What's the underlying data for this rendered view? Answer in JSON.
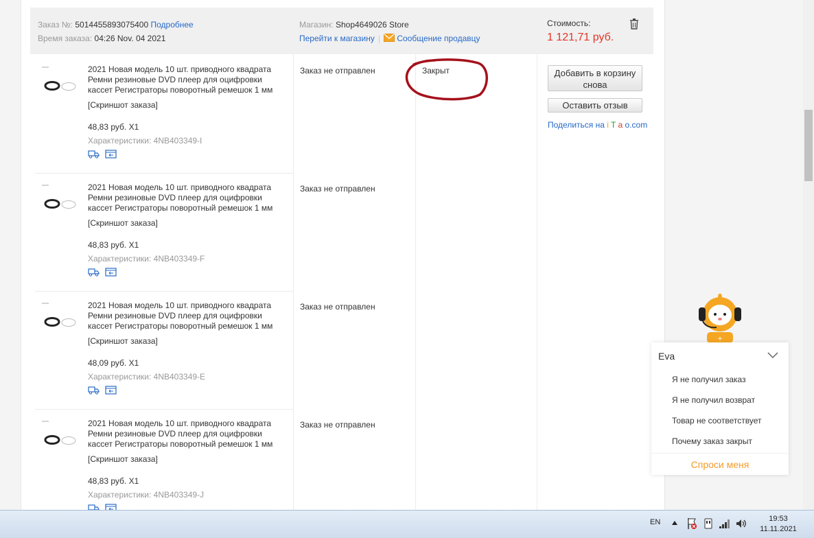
{
  "order": {
    "number_label": "Заказ №:",
    "number": "5014455893075400",
    "details_link": "Подробнее",
    "time_label": "Время заказа:",
    "time": "04:26 Nov. 04 2021",
    "store_label": "Магазин:",
    "store": "Shop4649026 Store",
    "go_store": "Перейти к магазину",
    "separator": "|",
    "message_seller": "Сообщение продавцу",
    "cost_label": "Стоимость:",
    "cost": "1 121,71 руб."
  },
  "items": [
    {
      "title": "2021 Новая модель 10 шт. приводного квадрата Ремни резиновые DVD плеер для оцифровки кассет Регистраторы поворотный ремешок 1 мм",
      "snapshot": "[Скриншот заказа]",
      "price": "48,83 руб. X1",
      "chars_label": "Характеристики:",
      "chars": "4NB403349-I",
      "status": "Заказ не отправлен"
    },
    {
      "title": "2021 Новая модель 10 шт. приводного квадрата Ремни резиновые DVD плеер для оцифровки кассет Регистраторы поворотный ремешок 1 мм",
      "snapshot": "[Скриншот заказа]",
      "price": "48,83 руб. X1",
      "chars_label": "Характеристики:",
      "chars": "4NB403349-F",
      "status": "Заказ не отправлен"
    },
    {
      "title": "2021 Новая модель 10 шт. приводного квадрата Ремни резиновые DVD плеер для оцифровки кассет Регистраторы поворотный ремешок 1 мм",
      "snapshot": "[Скриншот заказа]",
      "price": "48,09 руб. X1",
      "chars_label": "Характеристики:",
      "chars": "4NB403349-E",
      "status": "Заказ не отправлен"
    },
    {
      "title": "2021 Новая модель 10 шт. приводного квадрата Ремни резиновые DVD плеер для оцифровки кассет Регистраторы поворотный ремешок 1 мм",
      "snapshot": "[Скриншот заказа]",
      "price": "48,83 руб. X1",
      "chars_label": "Характеристики:",
      "chars": "4NB403349-J",
      "status": "Заказ не отправлен"
    }
  ],
  "order_status": "Закрыт",
  "actions": {
    "add_to_cart": "Добавить в корзину снова",
    "leave_review": "Оставить отзыв",
    "share_prefix": "Поделиться на ",
    "share_i": "i",
    "share_t": "T",
    "share_a": "a",
    "share_o": "o",
    "share_com": ".com"
  },
  "assistant": {
    "name": "Eva",
    "questions": [
      "Я не получил заказ",
      "Я не получил возврат",
      "Товар не соответствует",
      "Почему заказ закрыт"
    ],
    "ask_me": "Спроси меня"
  },
  "taskbar": {
    "lang": "EN",
    "time": "19:53",
    "date": "11.11.2021"
  },
  "colors": {
    "link": "#2669c8",
    "price": "#e53524",
    "annotation": "#a5111c",
    "assistant_accent": "#f59b26"
  }
}
